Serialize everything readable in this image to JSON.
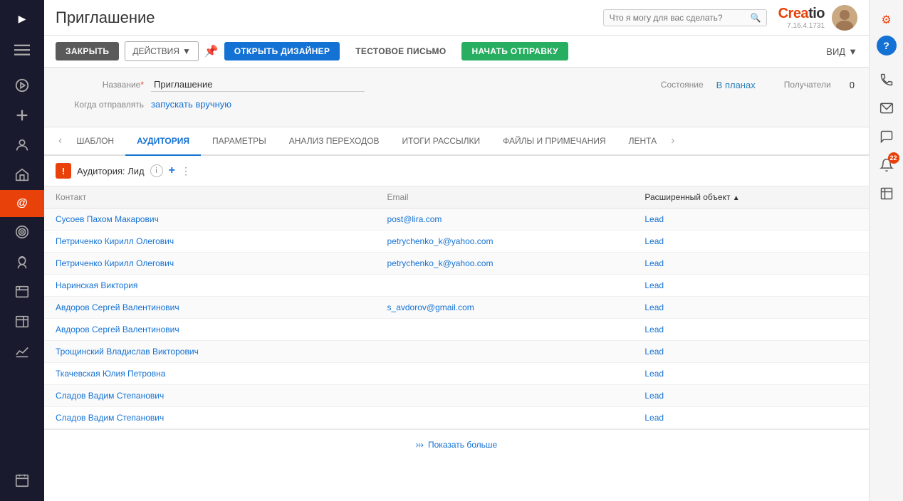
{
  "app": {
    "title": "Приглашение",
    "version": "7.16.4.1731",
    "search_placeholder": "Что я могу для вас сделать?"
  },
  "toolbar": {
    "close_label": "ЗАКРЫТЬ",
    "actions_label": "ДЕЙСТВИЯ",
    "open_designer_label": "ОТКРЫТЬ ДИЗАЙНЕР",
    "test_email_label": "ТЕСТОВОЕ ПИСЬМО",
    "start_send_label": "НАЧАТЬ ОТПРАВКУ",
    "view_label": "ВИД"
  },
  "form": {
    "name_label": "Название",
    "name_required": "*",
    "name_value": "Приглашение",
    "when_label": "Когда отправлять",
    "when_value": "запускать вручную",
    "status_label": "Состояние",
    "status_value": "В планах",
    "recipients_label": "Получатели",
    "recipients_value": "0"
  },
  "tabs": {
    "items": [
      {
        "id": "template",
        "label": "ШАБЛОН",
        "active": false
      },
      {
        "id": "audience",
        "label": "АУДИТОРИЯ",
        "active": true
      },
      {
        "id": "params",
        "label": "ПАРАМЕТРЫ",
        "active": false
      },
      {
        "id": "analysis",
        "label": "АНАЛИЗ ПЕРЕХОДОВ",
        "active": false
      },
      {
        "id": "results",
        "label": "ИТОГИ РАССЫЛКИ",
        "active": false
      },
      {
        "id": "files",
        "label": "ФАЙЛЫ И ПРИМЕЧАНИЯ",
        "active": false
      },
      {
        "id": "feed",
        "label": "ЛЕНТА",
        "active": false
      }
    ]
  },
  "audience": {
    "title": "Аудитория: Лид",
    "columns": [
      {
        "id": "contact",
        "label": "Контакт"
      },
      {
        "id": "email",
        "label": "Email"
      },
      {
        "id": "extended_obj",
        "label": "Расширенный объект",
        "sort": "desc"
      }
    ],
    "rows": [
      {
        "contact": "Сусоев Пахом Макарович",
        "email": "post@lira.com",
        "extended_obj": "Lead"
      },
      {
        "contact": "Петриченко Кирилл Олегович",
        "email": "petrychenko_k@yahoo.com",
        "extended_obj": "Lead"
      },
      {
        "contact": "Петриченко Кирилл Олегович",
        "email": "petrychenko_k@yahoo.com",
        "extended_obj": "Lead"
      },
      {
        "contact": "Наринская Виктория",
        "email": "",
        "extended_obj": "Lead"
      },
      {
        "contact": "Авдоров Сергей Валентинович",
        "email": "s_avdorov@gmail.com",
        "extended_obj": "Lead"
      },
      {
        "contact": "Авдоров Сергей Валентинович",
        "email": "",
        "extended_obj": "Lead"
      },
      {
        "contact": "Трощинский Владислав Викторович",
        "email": "",
        "extended_obj": "Lead"
      },
      {
        "contact": "Ткачевская Юлия Петровна",
        "email": "",
        "extended_obj": "Lead"
      },
      {
        "contact": "Сладов Вадим Степанович",
        "email": "",
        "extended_obj": "Lead"
      },
      {
        "contact": "Сладов Вадим Степанович",
        "email": "",
        "extended_obj": "Lead"
      }
    ],
    "show_more_label": "Показать больше"
  },
  "right_panel": {
    "notification_badge": "22"
  },
  "nav_items": [
    {
      "id": "collapse",
      "icon": "▶"
    },
    {
      "id": "menu",
      "icon": "☰"
    },
    {
      "id": "play",
      "icon": "▶"
    },
    {
      "id": "plus",
      "icon": "+"
    },
    {
      "id": "person",
      "icon": "👤"
    },
    {
      "id": "campaign",
      "icon": "📣"
    },
    {
      "id": "email-active",
      "icon": "@"
    },
    {
      "id": "target",
      "icon": "🎯"
    },
    {
      "id": "bulb",
      "icon": "💡"
    },
    {
      "id": "table1",
      "icon": "📊"
    },
    {
      "id": "table2",
      "icon": "📋"
    },
    {
      "id": "chart",
      "icon": "📈"
    },
    {
      "id": "calendar",
      "icon": "📅"
    }
  ]
}
